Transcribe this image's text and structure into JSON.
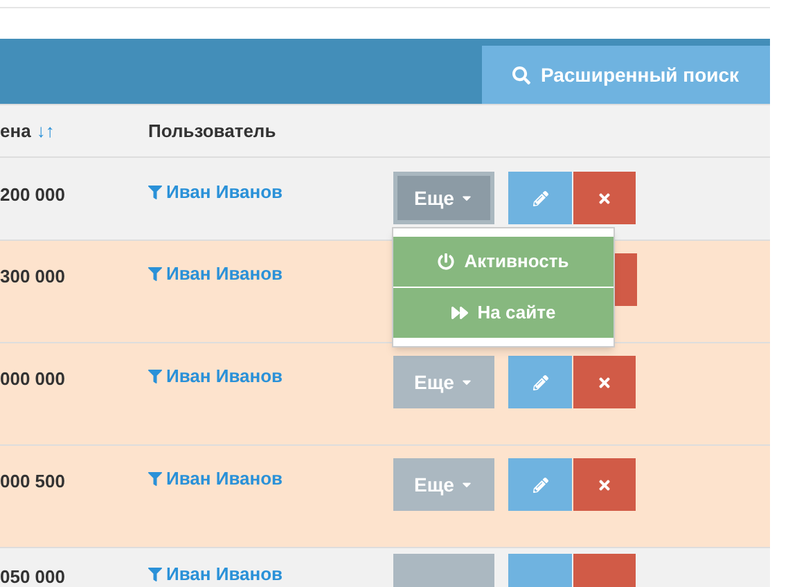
{
  "header": {
    "search_button": "Расширенный поиск"
  },
  "columns": [
    {
      "label": "ена",
      "sort_arrows": "↓↑"
    },
    {
      "label": "Пользователь"
    }
  ],
  "rows": [
    {
      "price": "200 000",
      "user": "Иван Иванов",
      "highlighted": false,
      "kind": "full",
      "more": "Еще",
      "open": true
    },
    {
      "price": "300 000",
      "user": "Иван Иванов",
      "highlighted": true,
      "kind": "covered"
    },
    {
      "price": "000 000",
      "user": "Иван Иванов",
      "highlighted": true,
      "kind": "full",
      "more": "Еще",
      "open": false
    },
    {
      "price": "000 500",
      "user": "Иван Иванов",
      "highlighted": true,
      "kind": "full",
      "more": "Еще",
      "open": false
    },
    {
      "price": "050 000",
      "user": "Иван Иванов",
      "highlighted": false,
      "kind": "cut"
    }
  ],
  "dropdown": {
    "items": [
      {
        "label": "Активность"
      },
      {
        "label": "На сайте"
      }
    ]
  }
}
